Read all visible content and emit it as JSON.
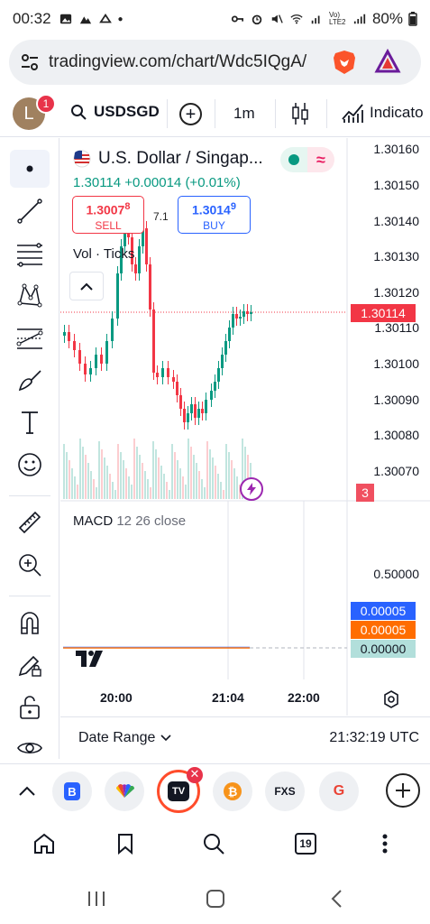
{
  "status": {
    "time": "00:32",
    "battery": "80%",
    "network": "Vo) LTE2"
  },
  "browser": {
    "url": "tradingview.com/chart/Wdc5IQgA/"
  },
  "toolbar": {
    "avatar_letter": "L",
    "notification_count": "1",
    "symbol": "USDSGD",
    "add_label": "+",
    "interval": "1m",
    "indicators_label": "Indicato"
  },
  "legend": {
    "title": "U.S. Dollar / Singap...",
    "last": "1.30114",
    "change": "+0.00014",
    "change_pct": "(+0.01%)",
    "sell_price_main": "1.3007",
    "sell_price_sup": "8",
    "sell_label": "SELL",
    "spread": "7.1",
    "buy_price_main": "1.3014",
    "buy_price_sup": "9",
    "buy_label": "BUY",
    "volume_label": "Vol · Ticks"
  },
  "price_axis": {
    "ticks": [
      "1.30160",
      "1.30150",
      "1.30140",
      "1.30130",
      "1.30120",
      "1.30110",
      "1.30100",
      "1.30090",
      "1.30080",
      "1.30070"
    ],
    "last_price_tag": "1.30114",
    "volume_tag": "3"
  },
  "macd": {
    "label": "MACD",
    "params": "12 26 close",
    "axis_tick": "0.50000",
    "tag_macd": "0.00005",
    "tag_signal": "0.00005",
    "tag_hist": "0.00000"
  },
  "time_axis": {
    "ticks": [
      "20:00",
      "21:04",
      "22:00"
    ]
  },
  "bottom": {
    "date_range": "Date Range",
    "utc_time": "21:32:19 UTC"
  },
  "tabs": [
    {
      "name": "B"
    },
    {
      "name": "NBC"
    },
    {
      "name": "TV"
    },
    {
      "name": "Bitcoin"
    },
    {
      "name": "FXS"
    },
    {
      "name": "G"
    }
  ],
  "nav": {
    "tab_count": "19"
  },
  "colors": {
    "up": "#089981",
    "down": "#f23645",
    "sell": "#f23645",
    "buy": "#2962ff",
    "macd_line": "#2962ff",
    "signal_line": "#ff6d00",
    "hist": "#b2dfdb"
  }
}
